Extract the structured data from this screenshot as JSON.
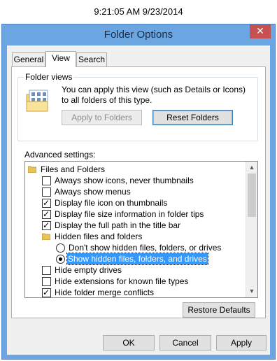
{
  "clock": "9:21:05 AM 9/23/2014",
  "window": {
    "title": "Folder Options",
    "close_glyph": "✕"
  },
  "tabs": [
    {
      "label": "General"
    },
    {
      "label": "View"
    },
    {
      "label": "Search"
    }
  ],
  "folder_views": {
    "label": "Folder views",
    "description": "You can apply this view (such as Details or Icons) to all folders of this type.",
    "apply_button": "Apply to Folders",
    "reset_button": "Reset Folders",
    "icon": "folder-views-icon"
  },
  "advanced": {
    "label": "Advanced settings:",
    "items": [
      {
        "kind": "folder",
        "label": "Files and Folders"
      },
      {
        "kind": "checkbox",
        "checked": false,
        "label": "Always show icons, never thumbnails"
      },
      {
        "kind": "checkbox",
        "checked": false,
        "label": "Always show menus"
      },
      {
        "kind": "checkbox",
        "checked": true,
        "label": "Display file icon on thumbnails"
      },
      {
        "kind": "checkbox",
        "checked": true,
        "label": "Display file size information in folder tips"
      },
      {
        "kind": "checkbox",
        "checked": true,
        "label": "Display the full path in the title bar"
      },
      {
        "kind": "folder",
        "label": "Hidden files and folders"
      },
      {
        "kind": "radio",
        "checked": false,
        "label": "Don't show hidden files, folders, or drives"
      },
      {
        "kind": "radio",
        "checked": true,
        "selected": true,
        "label": "Show hidden files, folders, and drives"
      },
      {
        "kind": "checkbox",
        "checked": false,
        "label": "Hide empty drives"
      },
      {
        "kind": "checkbox",
        "checked": false,
        "label": "Hide extensions for known file types"
      },
      {
        "kind": "checkbox",
        "checked": true,
        "label": "Hide folder merge conflicts"
      }
    ]
  },
  "restore_button": "Restore Defaults",
  "footer": {
    "ok": "OK",
    "cancel": "Cancel",
    "apply": "Apply"
  },
  "colors": {
    "frame": "#6ba6e2",
    "close": "#c75050",
    "selection": "#3399ff"
  }
}
